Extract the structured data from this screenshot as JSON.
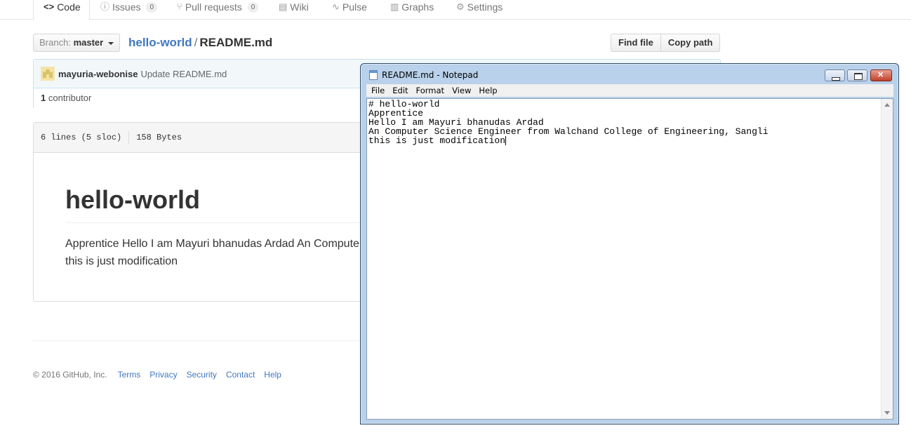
{
  "repo_nav": {
    "tabs": [
      {
        "label": "Code",
        "icon": "code-icon",
        "active": true
      },
      {
        "label": "Issues",
        "icon": "issue-icon",
        "count": "0"
      },
      {
        "label": "Pull requests",
        "icon": "pull-request-icon",
        "count": "0"
      },
      {
        "label": "Wiki",
        "icon": "book-icon"
      },
      {
        "label": "Pulse",
        "icon": "pulse-icon"
      },
      {
        "label": "Graphs",
        "icon": "graph-icon"
      },
      {
        "label": "Settings",
        "icon": "gear-icon"
      }
    ]
  },
  "file_nav": {
    "branch_label": "Branch:",
    "branch_name": "master",
    "repo_name": "hello-world",
    "separator": "/",
    "file_name": "README.md",
    "find_file": "Find file",
    "copy_path": "Copy path"
  },
  "commit": {
    "author": "mayuria-webonise",
    "message": "Update README.md",
    "contributor_count": "1",
    "contributor_label": "contributor"
  },
  "file_info": {
    "lines": "6 lines (5 sloc)",
    "size": "158 Bytes"
  },
  "readme": {
    "heading": "hello-world",
    "paragraph": "Apprentice Hello I am Mayuri bhanudas Ardad An Computer Science Engineer from Walchand College of Engineering, Sangli this is just modification"
  },
  "footer": {
    "copyright": "© 2016 GitHub, Inc.",
    "links": [
      "Terms",
      "Privacy",
      "Security",
      "Contact",
      "Help"
    ]
  },
  "notepad": {
    "title": "README.md - Notepad",
    "menu": [
      "File",
      "Edit",
      "Format",
      "View",
      "Help"
    ],
    "lines": [
      "# hello-world",
      "Apprentice",
      "Hello I am Mayuri bhanudas Ardad",
      "An Computer Science Engineer from Walchand College of Engineering, Sangli",
      "this is just modification"
    ]
  },
  "colors": {
    "link_blue": "#4078c0",
    "notepad_frame": "#b9d1ea",
    "close_red": "#c2402a"
  }
}
